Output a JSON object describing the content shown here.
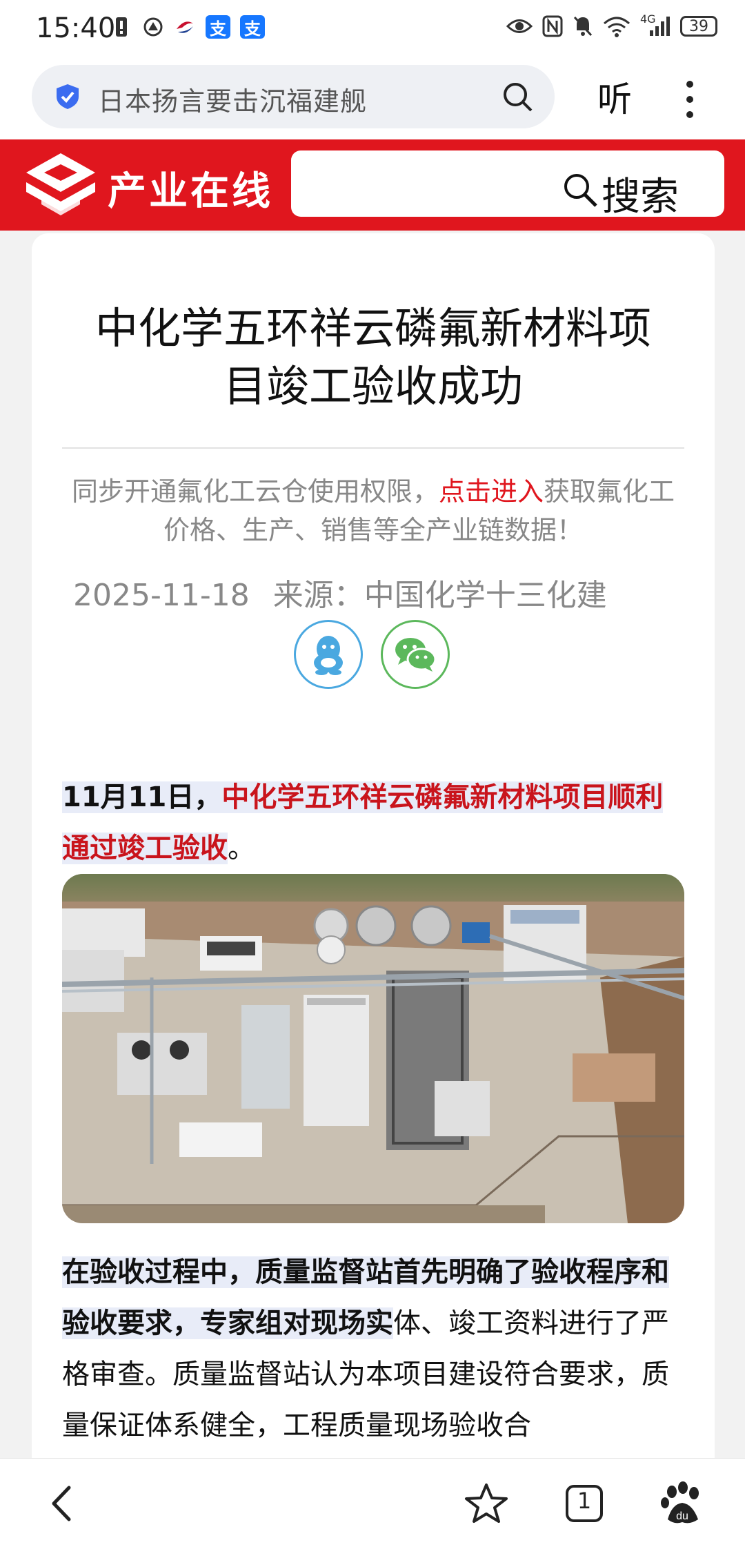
{
  "status_bar": {
    "time": "15:40",
    "network": "4G",
    "battery": "39",
    "left_icons": [
      "alert-icon",
      "app-icon",
      "app-icon",
      "alipay-icon",
      "alipay-icon"
    ],
    "right_icons": [
      "eye-icon",
      "nfc-icon",
      "mute-icon",
      "wifi-icon",
      "signal-icon",
      "battery-icon"
    ]
  },
  "browser": {
    "url_text": "日本扬言要击沉福建舰",
    "listen_label": "听"
  },
  "site": {
    "logo_text": "产业在线",
    "search_label": "搜索",
    "brand_color": "#e0161e"
  },
  "article": {
    "title": "中化学五环祥云磷氟新材料项目竣工验收成功",
    "notice_before": "同步开通氟化工云仓使用权限，",
    "notice_link": "点击进入",
    "notice_after": "获取氟化工价格、生产、销售等全产业链数据！",
    "date": "2025-11-18",
    "source": "来源：中国化学十三化建",
    "lead_date": "11月11日，",
    "lead_highlight": "中化学五环祥云磷氟新材料项目顺利通过竣工验收",
    "lead_end": "。",
    "body_bold": "在验收过程中，质量监督站首先明确了验收程序和验收要求，专家组对现场实",
    "body_rest": "体、竣工资料进行了严格审查。质量监督站认为本项目建设符合要求，质量保证体系健全，工程质量现场验收合"
  },
  "bottom_nav": {
    "tab_count": "1",
    "icons": [
      "back-icon",
      "star-icon",
      "tabs-icon",
      "baidu-icon"
    ]
  }
}
